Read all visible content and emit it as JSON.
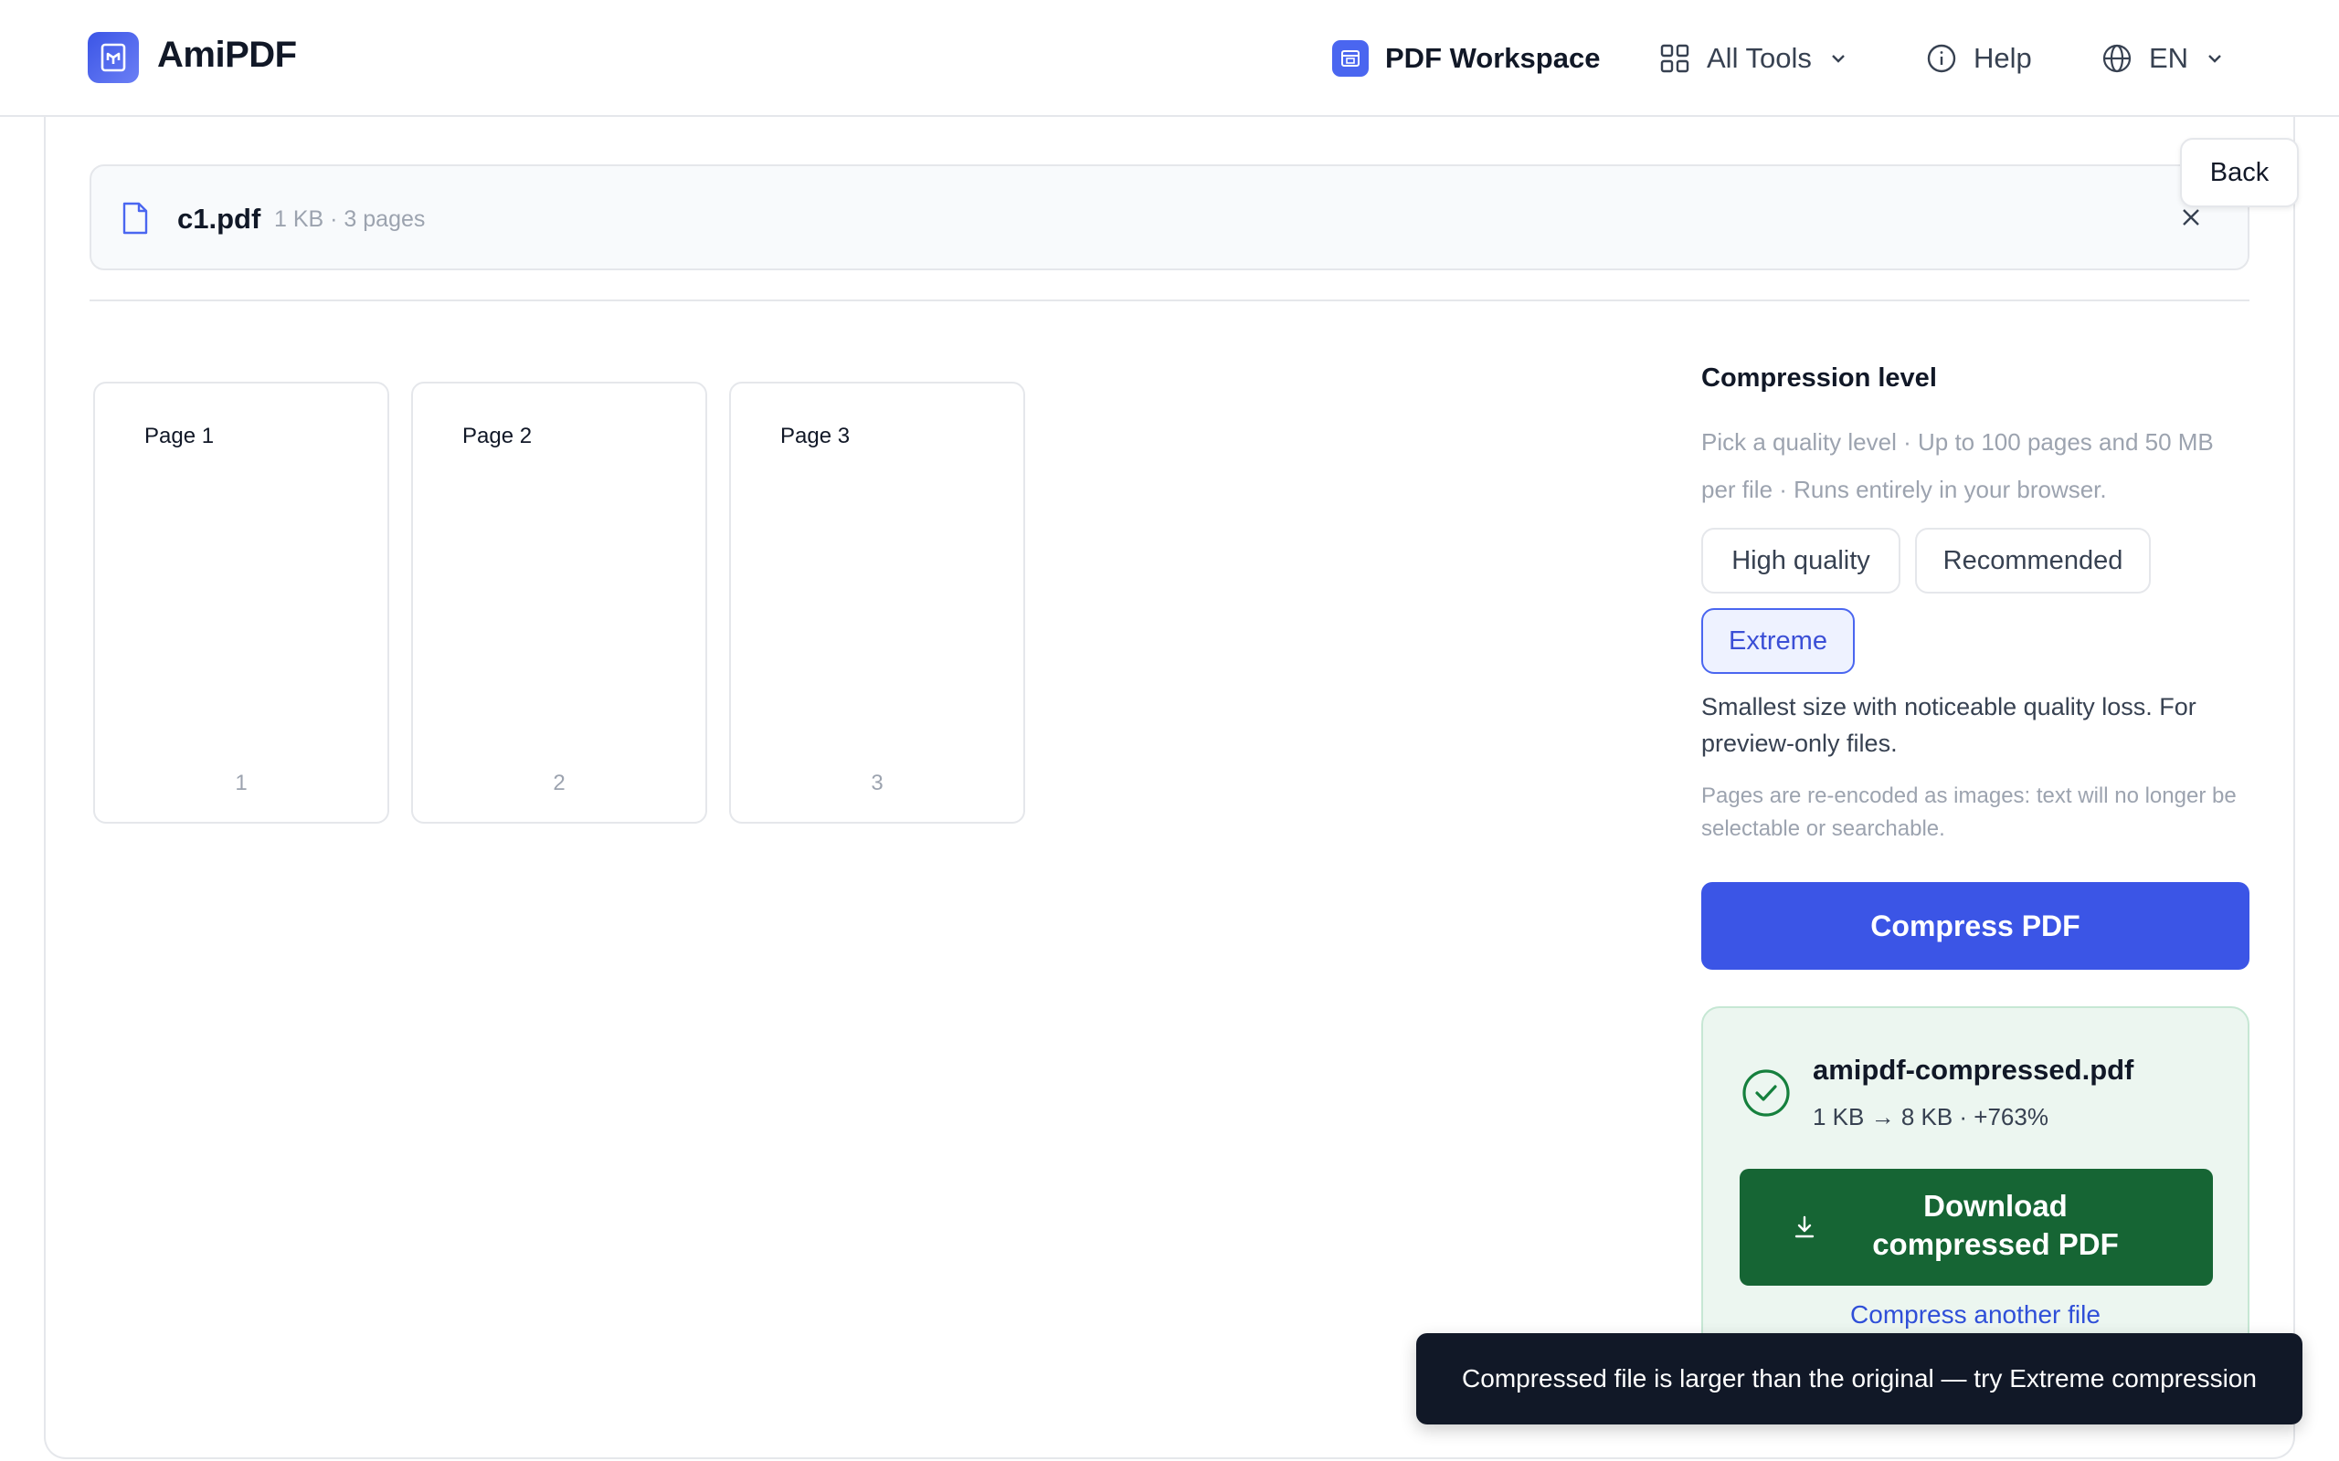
{
  "header": {
    "brand": "AmiPDF",
    "nav": {
      "workspace": "PDF Workspace",
      "all_tools": "All Tools",
      "help": "Help",
      "language": "EN"
    }
  },
  "back_label": "Back",
  "file": {
    "name": "c1.pdf",
    "meta": "1 KB · 3 pages"
  },
  "pages": [
    {
      "label": "Page 1",
      "number": "1"
    },
    {
      "label": "Page 2",
      "number": "2"
    },
    {
      "label": "Page 3",
      "number": "3"
    }
  ],
  "compression": {
    "title": "Compression level",
    "description": "Pick a quality level · Up to 100 pages and 50 MB per file · Runs entirely in your browser.",
    "options": {
      "high": "High quality",
      "recommended": "Recommended",
      "extreme": "Extreme"
    },
    "selected": "Extreme",
    "level_description": "Smallest size with noticeable quality loss. For preview-only files.",
    "note": "Pages are re-encoded as images: text will no longer be selectable or searchable.",
    "compress_label": "Compress PDF"
  },
  "result": {
    "filename": "amipdf-compressed.pdf",
    "size_change": "1 KB → 8 KB · +763%",
    "download_label": "Download compressed PDF",
    "another_label": "Compress another file"
  },
  "toast": "Compressed file is larger than the original — try Extreme compression",
  "colors": {
    "accent": "#3b55e6",
    "success": "#166534",
    "success_bg": "#ecf6f0",
    "toast_bg": "#111827"
  }
}
